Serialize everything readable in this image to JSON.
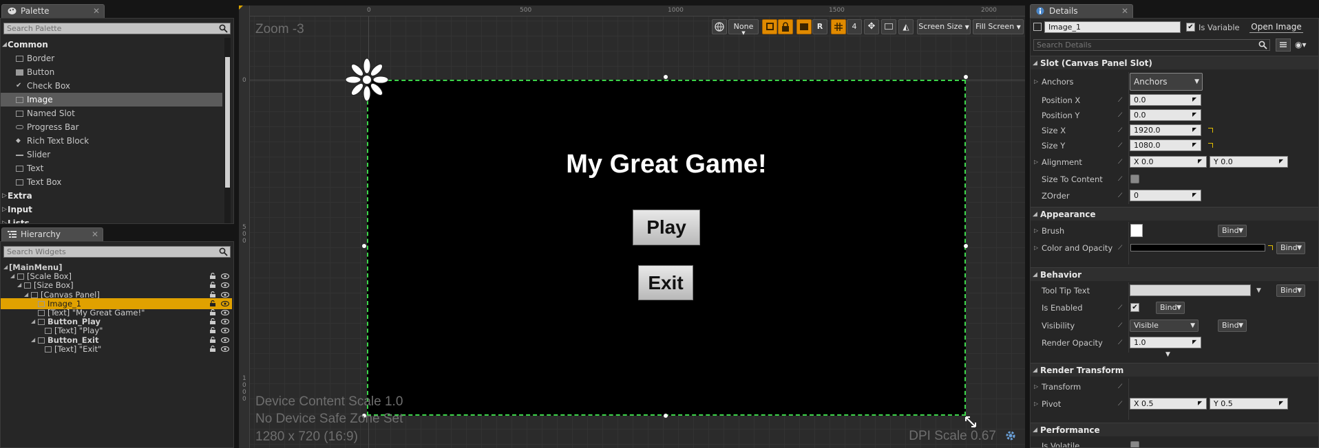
{
  "palette": {
    "tab_label": "Palette",
    "search_placeholder": "Search Palette",
    "categories": {
      "common": "Common",
      "extra": "Extra",
      "input": "Input",
      "lists": "Lists"
    },
    "items": [
      "Border",
      "Button",
      "Check Box",
      "Image",
      "Named Slot",
      "Progress Bar",
      "Rich Text Block",
      "Slider",
      "Text",
      "Text Box"
    ],
    "selected_item": "Image"
  },
  "hierarchy": {
    "tab_label": "Hierarchy",
    "search_placeholder": "Search Widgets",
    "rows": [
      "[MainMenu]",
      "[Scale Box]",
      "[Size Box]",
      "[Canvas Panel]",
      "Image_1",
      "[Text] \"My Great Game!\"",
      "Button_Play",
      "[Text] \"Play\"",
      "Button_Exit",
      "[Text] \"Exit\""
    ],
    "selected_row": "Image_1"
  },
  "viewport": {
    "zoom_label": "Zoom -3",
    "ruler_top": [
      "0",
      "500",
      "1000",
      "1500",
      "2000"
    ],
    "ruler_left": [
      "0",
      "5\n0\n0",
      "1\n0\n0\n0"
    ],
    "toolbar": {
      "none": "None",
      "r": "R",
      "grid_num": "4",
      "screen_size": "Screen Size",
      "fill_screen": "Fill Screen"
    },
    "device_content_scale": "Device Content Scale 1.0",
    "safe_zone": "No Device Safe Zone Set",
    "resolution": "1280 x 720 (16:9)",
    "dpi_scale": "DPI Scale 0.67",
    "canvas": {
      "title": "My Great Game!",
      "play": "Play",
      "exit": "Exit"
    }
  },
  "details": {
    "tab_label": "Details",
    "name_value": "Image_1",
    "is_variable_label": "Is Variable",
    "open_image": "Open Image",
    "search_placeholder": "Search Details",
    "slot_section": "Slot (Canvas Panel Slot)",
    "anchors_label": "Anchors",
    "anchors_value": "Anchors",
    "position_x_label": "Position X",
    "position_x": "0.0",
    "position_y_label": "Position Y",
    "position_y": "0.0",
    "size_x_label": "Size X",
    "size_x": "1920.0",
    "size_y_label": "Size Y",
    "size_y": "1080.0",
    "alignment_label": "Alignment",
    "alignment_x": "X  0.0",
    "alignment_y": "Y  0.0",
    "size_to_content_label": "Size To Content",
    "zorder_label": "ZOrder",
    "zorder": "0",
    "appearance_section": "Appearance",
    "brush_label": "Brush",
    "color_label": "Color and Opacity",
    "bind": "Bind",
    "behavior_section": "Behavior",
    "tooltip_label": "Tool Tip Text",
    "enabled_label": "Is Enabled",
    "visibility_label": "Visibility",
    "visibility_value": "Visible",
    "render_opacity_label": "Render Opacity",
    "render_opacity": "1.0",
    "render_transform_section": "Render Transform",
    "transform_label": "Transform",
    "pivot_label": "Pivot",
    "pivot_x": "X  0.5",
    "pivot_y": "Y  0.5",
    "performance_section": "Performance",
    "is_volatile_label": "Is Volatile"
  },
  "colors": {
    "accent": "#e0a100",
    "selection_green": "#3cd64a",
    "toolbar_active": "#e08a00"
  }
}
